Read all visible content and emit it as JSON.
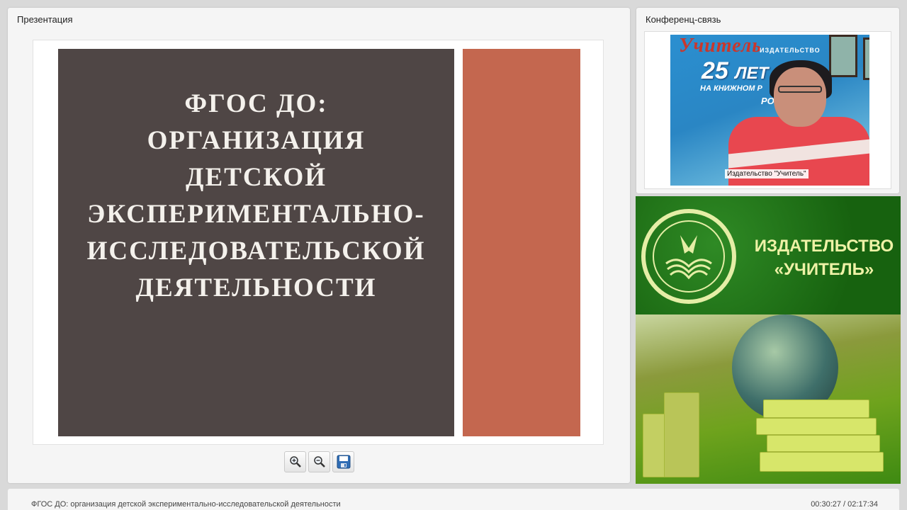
{
  "presentation": {
    "panel_title": "Презентация",
    "slide": {
      "title_lines": [
        "ФГОС ДО:",
        "ОРГАНИЗАЦИЯ",
        "ДЕТСКОЙ",
        "ЭКСПЕРИМЕНТАЛЬНО-",
        "ИССЛЕДОВАТЕЛЬСКОЙ",
        "ДЕЯТЕЛЬНОСТИ"
      ],
      "colors": {
        "left": "#4f4645",
        "right": "#c4674f",
        "text": "#f4f1ec"
      }
    },
    "tools": [
      {
        "name": "zoom-in",
        "icon": "zoom-in-icon"
      },
      {
        "name": "zoom-out",
        "icon": "zoom-out-icon"
      },
      {
        "name": "save",
        "icon": "floppy-disk-icon"
      }
    ]
  },
  "conference": {
    "panel_title": "Конференц-связь",
    "video_label": "Издательство \"Учитель\"",
    "poster": {
      "title": "Учитель",
      "subtitle": "ИЗДАТЕЛЬСТВО",
      "number": "25",
      "number_suffix": "ЛЕТ",
      "line1": "НА КНИЖНОМ Р",
      "line2": "РОСС"
    }
  },
  "logo": {
    "line1": "ИЗДАТЕЛЬСТВО",
    "line2": "«УЧИТЕЛЬ»",
    "colors": {
      "bg": "#1f6e18",
      "text": "#eef2a6"
    }
  },
  "status": {
    "title": "ФГОС ДО: организация детской экспериментально-исследовательской деятельности",
    "time": "00:30:27 / 02:17:34"
  }
}
